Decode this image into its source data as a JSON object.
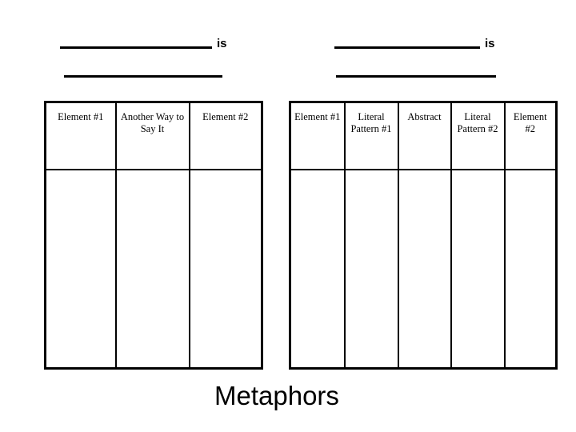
{
  "page_title": "Metaphors",
  "prompts": {
    "left": [
      {
        "blank": "__________",
        "suffix": "is"
      },
      {
        "blank": "__________",
        "suffix": ""
      }
    ],
    "right": [
      {
        "blank": "__________",
        "suffix": "is"
      },
      {
        "blank": "__________",
        "suffix": ""
      }
    ]
  },
  "tables": {
    "left": {
      "headers": [
        "Element #1",
        "Another Way to Say It",
        "Element #2"
      ],
      "answer_row": [
        "",
        "",
        ""
      ]
    },
    "right": {
      "headers": [
        "Element #1",
        "Literal Pattern #1",
        "Abstract",
        "Literal Pattern #2",
        "Element #2"
      ],
      "answer_row": [
        "",
        "",
        "",
        "",
        ""
      ]
    }
  }
}
